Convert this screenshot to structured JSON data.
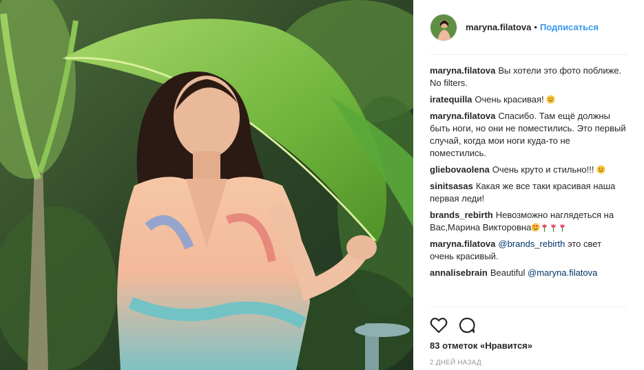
{
  "header": {
    "username": "maryna.filatova",
    "separator": "•",
    "follow_label": "Подписаться"
  },
  "comments": [
    {
      "user": "maryna.filatova",
      "text": "Вы хотели это фото поближе. No filters."
    },
    {
      "user": "iratequilla",
      "text": "Очень красивая!",
      "emoji": [
        "smile-emoji-icon"
      ]
    },
    {
      "user": "maryna.filatova",
      "text": "Спасибо. Там ещё должны быть ноги, но они не поместились. Это первый случай, когда мои ноги куда-то не поместились."
    },
    {
      "user": "gliebovaolena",
      "text": "Очень круто и стильно!!!",
      "emoji": [
        "smile-emoji-icon"
      ]
    },
    {
      "user": "sinitsasas",
      "text": "Какая же все таки красивая наша первая леди!"
    },
    {
      "user": "brands_rebirth",
      "text": "Невозможно наглядеться на Вас,Марина Викторовна",
      "emoji": [
        "heart-eyes-emoji-icon",
        "tulip-emoji-icon",
        "tulip-emoji-icon",
        "tulip-emoji-icon"
      ]
    },
    {
      "user": "maryna.filatova",
      "mention": "@brands_rebirth",
      "text": "это свет очень красивый."
    },
    {
      "user": "annalisebrain",
      "text": "Beautiful",
      "mention_after": "@maryna.filatova"
    }
  ],
  "footer": {
    "like_icon": "heart-outline-icon",
    "comment_icon": "comment-bubble-icon",
    "likes_text": "83 отметок «Нравится»",
    "timestamp": "2 дней назад"
  },
  "colors": {
    "link": "#3897f0",
    "mention": "#003569",
    "text": "#262626",
    "muted": "#999999",
    "divider": "#efefef"
  }
}
